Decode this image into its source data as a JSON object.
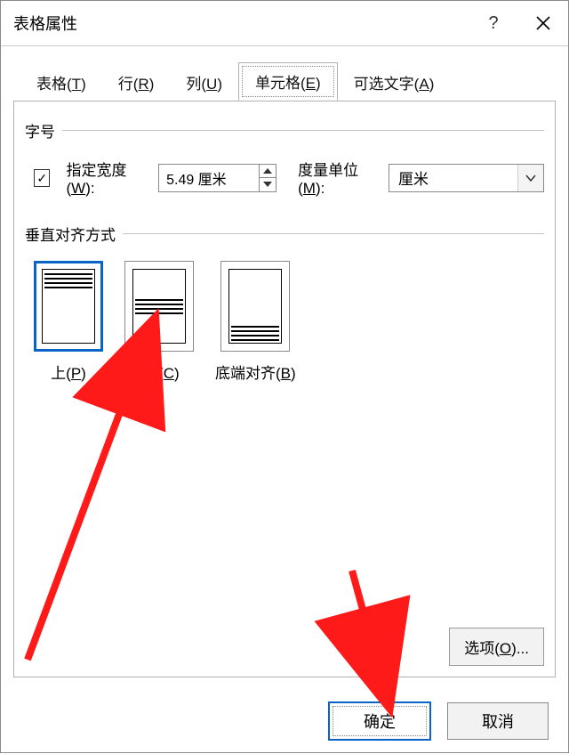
{
  "titlebar": {
    "title": "表格属性"
  },
  "tabs": {
    "table": {
      "label_pre": "表格(",
      "hot": "T",
      "label_post": ")"
    },
    "row": {
      "label_pre": "行(",
      "hot": "R",
      "label_post": ")"
    },
    "col": {
      "label_pre": "列(",
      "hot": "U",
      "label_post": ")"
    },
    "cell": {
      "label_pre": "单元格(",
      "hot": "E",
      "label_post": ")"
    },
    "alt": {
      "label_pre": "可选文字(",
      "hot": "A",
      "label_post": ")"
    }
  },
  "groups": {
    "size_title": "字号",
    "valign_title": "垂直对齐方式"
  },
  "size": {
    "check_label_pre": "指定宽度(",
    "check_hot": "W",
    "check_label_post": "):",
    "checked": "✓",
    "width_value": "5.49 厘米",
    "unit_label_pre": "度量单位(",
    "unit_hot": "M",
    "unit_label_post": "):",
    "unit_value": "厘米"
  },
  "valign": {
    "top": {
      "label_pre": "上(",
      "hot": "P",
      "label_post": ")"
    },
    "center": {
      "label_pre": "居 (",
      "hot": "C",
      "label_post": ")"
    },
    "bottom": {
      "label_pre": "底端对齐(",
      "hot": "B",
      "label_post": ")"
    }
  },
  "buttons": {
    "options_pre": "选项(",
    "options_hot": "O",
    "options_post": ")...",
    "ok": "确定",
    "cancel": "取消"
  }
}
